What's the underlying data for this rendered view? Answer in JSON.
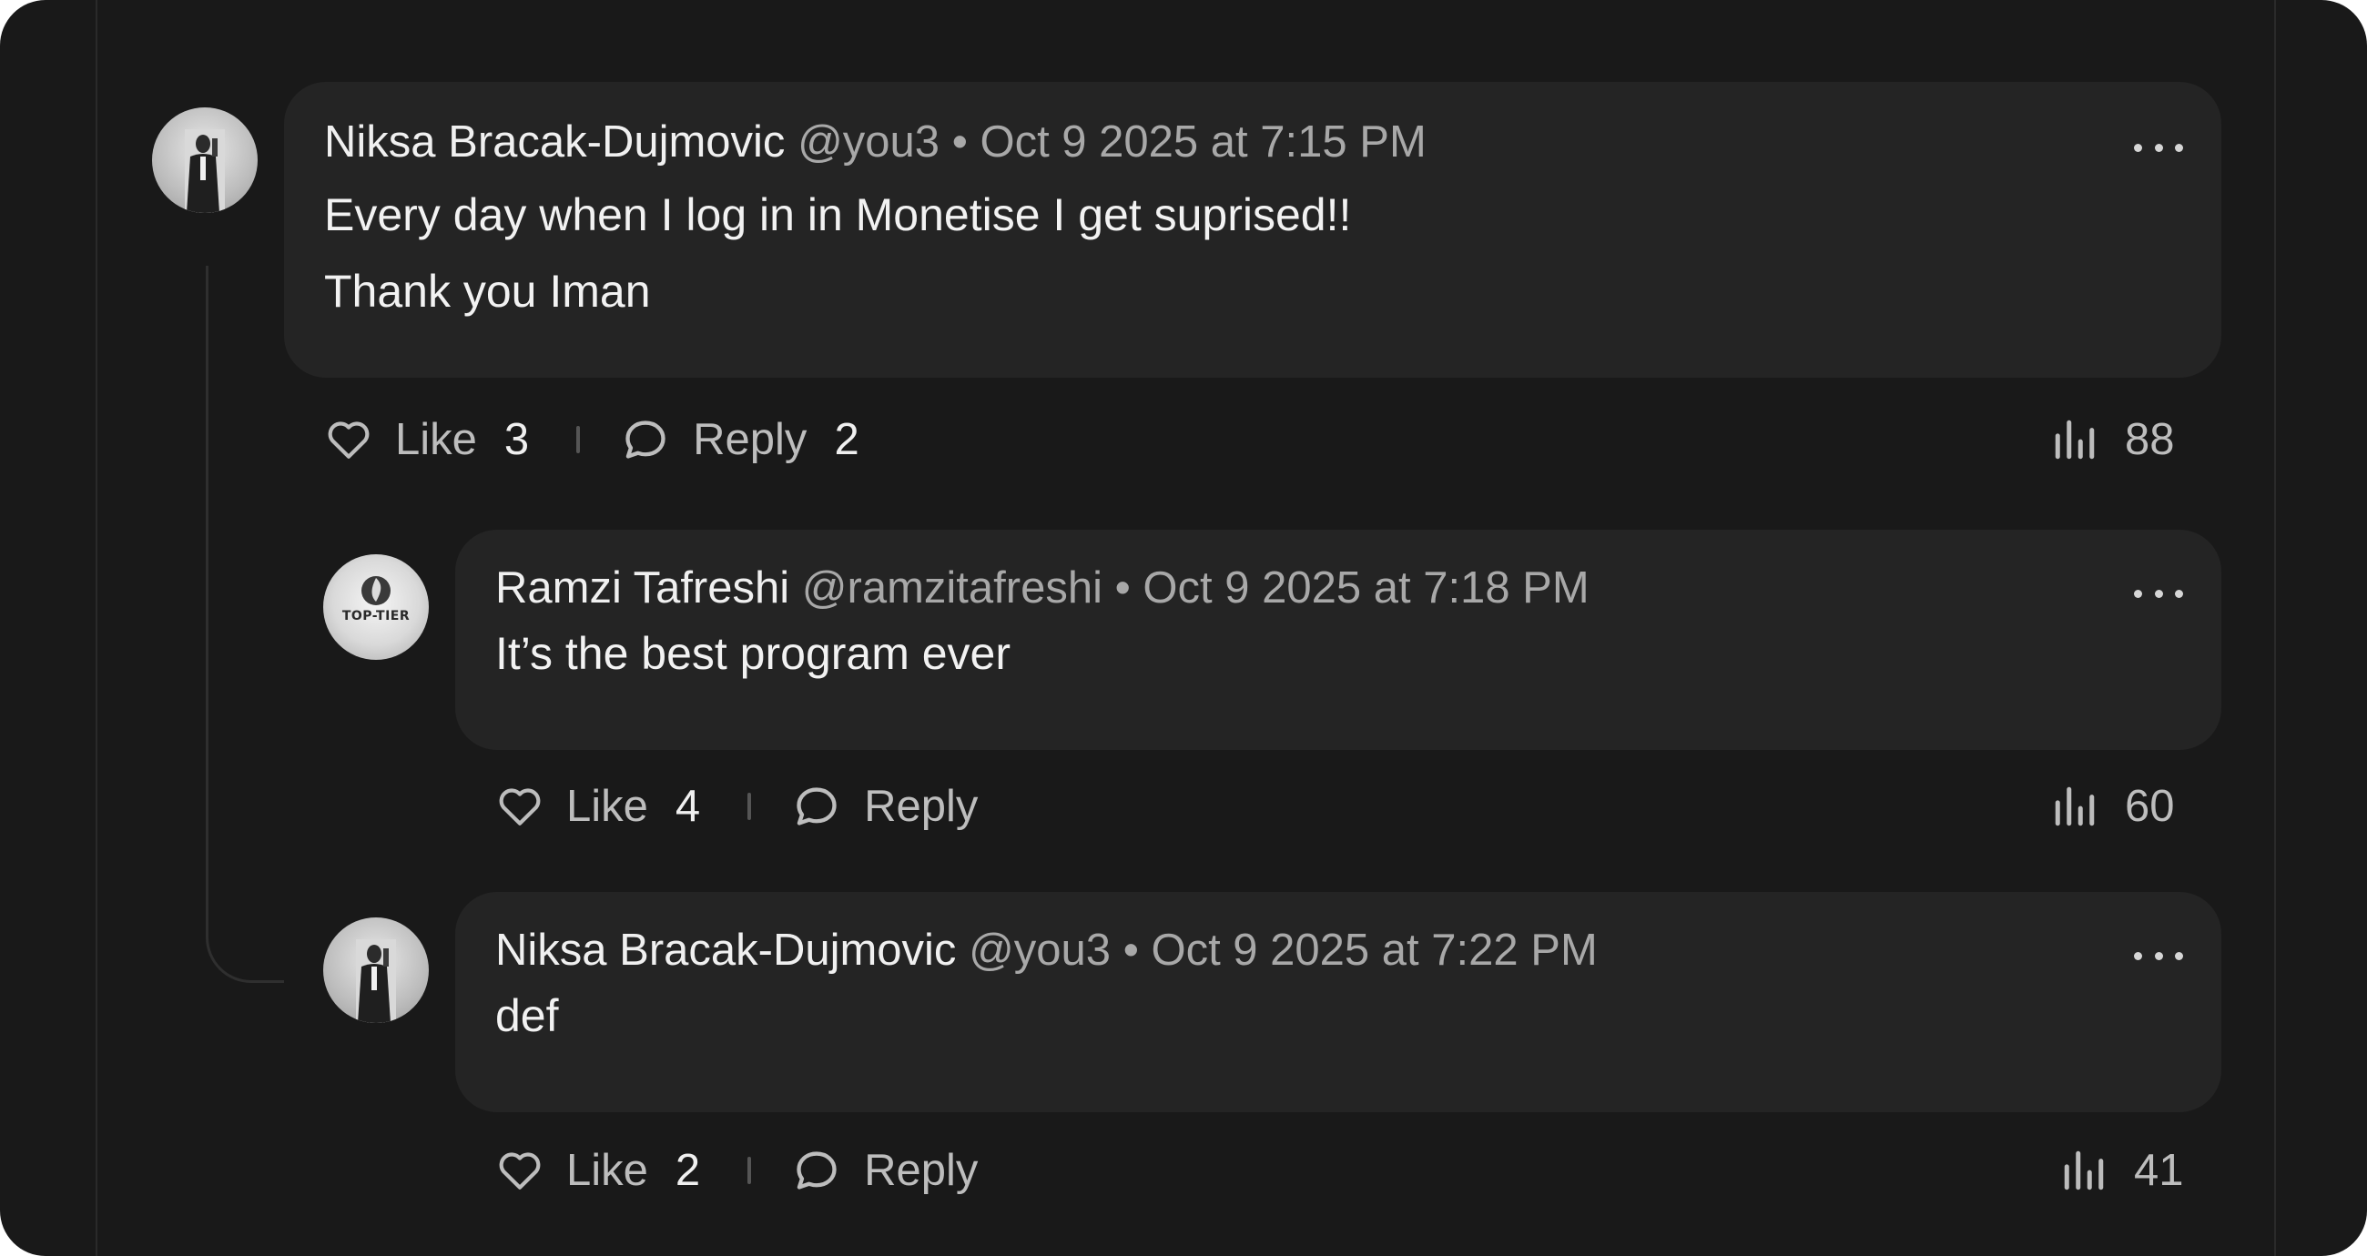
{
  "comments": [
    {
      "name": "Niksa Bracak-Dujmovic",
      "handle": "@you3",
      "separator": "•",
      "date": "Oct 9 2025 at 7:15 PM",
      "lines": [
        "Every day when I log in in Monetise I get suprised!!",
        "Thank you Iman"
      ],
      "like_label": "Like",
      "like_count": "3",
      "reply_label": "Reply",
      "reply_count": "2",
      "views": "88",
      "avatar": "profile-photo"
    },
    {
      "name": "Ramzi Tafreshi",
      "handle": "@ramzitafreshi",
      "separator": "•",
      "date": "Oct 9 2025 at 7:18 PM",
      "lines": [
        "It’s the best program ever"
      ],
      "like_label": "Like",
      "like_count": "4",
      "reply_label": "Reply",
      "views": "60",
      "avatar": "top-tier-logo",
      "avatar_text": "TOP-TIER"
    },
    {
      "name": "Niksa Bracak-Dujmovic",
      "handle": "@you3",
      "separator": "•",
      "date": "Oct 9 2025 at 7:22 PM",
      "lines": [
        "def"
      ],
      "like_label": "Like",
      "like_count": "2",
      "reply_label": "Reply",
      "views": "41",
      "avatar": "profile-photo"
    }
  ],
  "colors": {
    "background": "#191919",
    "bubble": "#242424",
    "text": "#f2f2f2",
    "muted": "#a8a8a8"
  }
}
